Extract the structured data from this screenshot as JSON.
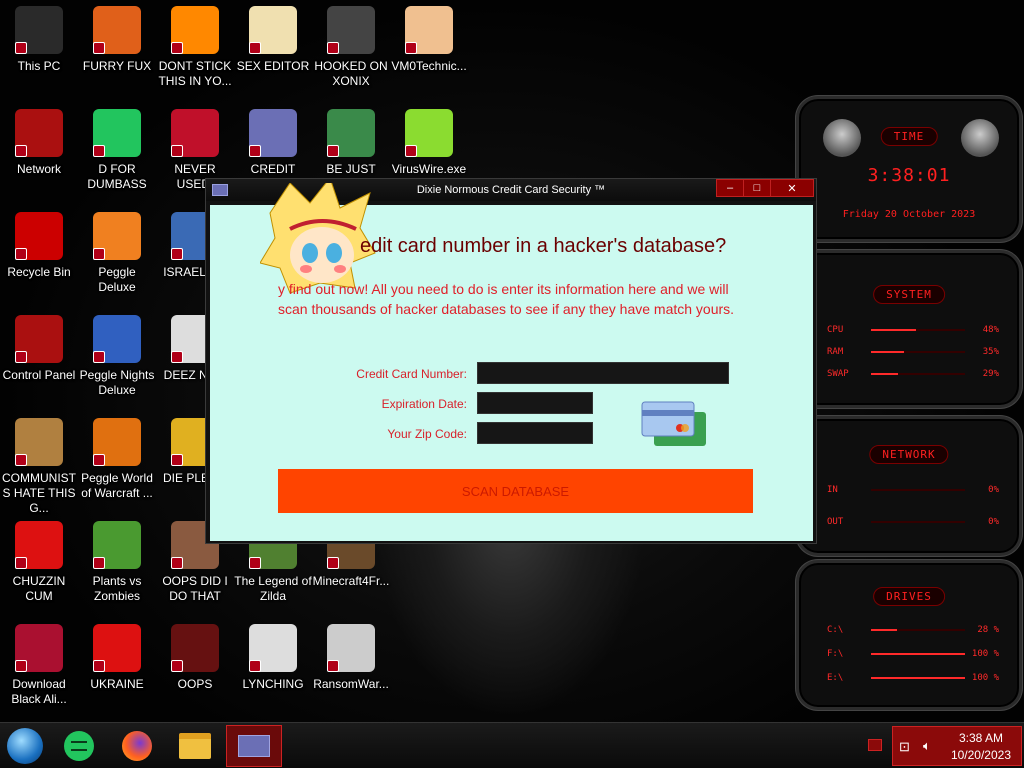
{
  "colors": {
    "accent_red": "#ff2020",
    "dialog_bg": "#ccfaf0",
    "scan_button": "#ff4400",
    "tray_bg": "#8b0a0a"
  },
  "desktop": {
    "icons": [
      {
        "label": "This PC",
        "icon": "monitor-icon",
        "color": "#2a2a2a"
      },
      {
        "label": "FURRY FUX",
        "icon": "firefox-icon",
        "color": "#e0601a"
      },
      {
        "label": "DONT STICK THIS IN YO...",
        "icon": "vlc-cone-icon",
        "color": "#ff8800"
      },
      {
        "label": "SEX EDITOR",
        "icon": "hxd-icon",
        "color": "#f0e0b0"
      },
      {
        "label": "HOOKED ON XONIX",
        "icon": "xonix-icon",
        "color": "#444444"
      },
      {
        "label": "VM0Technic...",
        "icon": "doctor-icon",
        "color": "#f0c090"
      },
      {
        "label": "Network",
        "icon": "network-icon",
        "color": "#aa1010"
      },
      {
        "label": "D FOR DUMBASS",
        "icon": "chat-icon",
        "color": "#22c55e"
      },
      {
        "label": "NEVER USED!",
        "icon": "devcpp-icon",
        "color": "#c0102a"
      },
      {
        "label": "CREDIT CARD CHECKER",
        "icon": "credit-card-icon",
        "color": "#6b6fb5"
      },
      {
        "label": "BE JUST LIKE THE DUDE!",
        "icon": "elf-icon",
        "color": "#3a8a4a"
      },
      {
        "label": "VirusWire.exe",
        "icon": "lime-icon",
        "color": "#8bdc30"
      },
      {
        "label": "Recycle Bin",
        "icon": "recycle-bin-icon",
        "color": "#cc0000"
      },
      {
        "label": "Peggle Deluxe",
        "icon": "peggle-icon",
        "color": "#f08020"
      },
      {
        "label": "ISRAEL S...",
        "icon": "folder-icon",
        "color": "#3a6ab5"
      },
      {
        "label": "Control Panel",
        "icon": "control-panel-icon",
        "color": "#aa1010"
      },
      {
        "label": "Peggle Nights Deluxe",
        "icon": "peggle-nights-icon",
        "color": "#3060c0"
      },
      {
        "label": "DEEZ NU...",
        "icon": "winx-icon",
        "color": "#dddddd"
      },
      {
        "label": "COMMUNISTS HATE THIS G...",
        "icon": "money-bag-icon",
        "color": "#b08040"
      },
      {
        "label": "Peggle World of Warcraft ...",
        "icon": "peggle-wow-icon",
        "color": "#e07010"
      },
      {
        "label": "DIE PLEA...",
        "icon": "die-icon",
        "color": "#e0b020"
      },
      {
        "label": "CHUZZIN CUM",
        "icon": "chuzzle-icon",
        "color": "#dd1111"
      },
      {
        "label": "Plants vs Zombies",
        "icon": "pvz-icon",
        "color": "#4a9a30"
      },
      {
        "label": "OOPS DID I DO THAT",
        "icon": "portrait-icon",
        "color": "#8a5a40"
      },
      {
        "label": "The Legend of Zilda",
        "icon": "zelda-icon",
        "color": "#508030"
      },
      {
        "label": "Minecraft4Fr...",
        "icon": "minecraft-icon",
        "color": "#6a4a2a"
      },
      {
        "label": "Download Black Ali...",
        "icon": "alien-orb-icon",
        "color": "#aa1030"
      },
      {
        "label": "UKRAINE",
        "icon": "radiation-icon",
        "color": "#dd1111"
      },
      {
        "label": "OOPS",
        "icon": "skull-book-icon",
        "color": "#661111"
      },
      {
        "label": "LYNCHING",
        "icon": "noose-icon",
        "color": "#dddddd"
      },
      {
        "label": "RansomWar...",
        "icon": "skull-icon",
        "color": "#cccccc"
      }
    ]
  },
  "widgets": {
    "time": {
      "caption": "TIME",
      "clock": "3:38:01",
      "date": "Friday 20 October 2023"
    },
    "system": {
      "caption": "SYSTEM",
      "rows": [
        {
          "name": "CPU",
          "pct": "48%",
          "fill": 0.48
        },
        {
          "name": "RAM",
          "pct": "35%",
          "fill": 0.35
        },
        {
          "name": "SWAP",
          "pct": "29%",
          "fill": 0.29
        }
      ]
    },
    "network": {
      "caption": "NETWORK",
      "rows": [
        {
          "name": "IN",
          "pct": "0%"
        },
        {
          "name": "OUT",
          "pct": "0%"
        }
      ]
    },
    "drives": {
      "caption": "DRIVES",
      "rows": [
        {
          "name": "C:\\",
          "pct": "28 %",
          "fill": 0.28
        },
        {
          "name": "F:\\",
          "pct": "100 %",
          "fill": 1.0
        },
        {
          "name": "E:\\",
          "pct": "100 %",
          "fill": 1.0
        }
      ]
    }
  },
  "dialog": {
    "title": "Dixie Normous Credit Card Security ™",
    "headline": "edit card number in a hacker's database?",
    "intro": "y find out now! All you need to do is enter its information here and we will scan thousands of hacker databases to see if any they have match yours.",
    "fields": {
      "card_label": "Credit Card Number:",
      "expiry_label": "Expiration Date:",
      "zip_label": "Your Zip Code:",
      "card_value": "",
      "expiry_value": "",
      "zip_value": ""
    },
    "scan_button": "SCAN DATABASE"
  },
  "taskbar": {
    "items": [
      "start-orb-icon",
      "chat-icon",
      "firefox-icon",
      "file-explorer-icon",
      "credit-card-icon"
    ],
    "clock_time": "3:38 AM",
    "clock_date": "10/20/2023"
  }
}
